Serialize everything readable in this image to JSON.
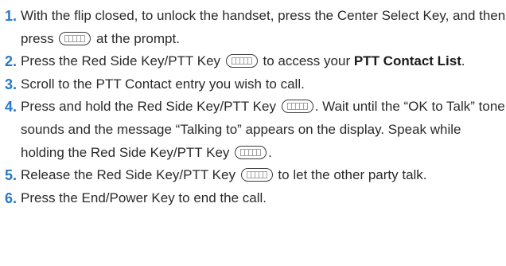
{
  "steps": [
    {
      "num": "1.",
      "text_a": "With the flip closed, to unlock the handset, press the Center Select Key, and then press",
      "text_b": "at the prompt."
    },
    {
      "num": "2.",
      "text_a": "Press the Red Side Key/PTT Key",
      "text_b": "to access your",
      "bold": "PTT Contact List",
      "text_c": "."
    },
    {
      "num": "3.",
      "text_a": "Scroll to the PTT Contact entry you wish to call."
    },
    {
      "num": "4.",
      "text_a": "Press and hold the Red Side Key/PTT Key",
      "text_b": ". Wait until the “OK to Talk” tone sounds and the message “Talking to” appears on the display. Speak while holding the Red Side Key/PTT Key",
      "text_c": "."
    },
    {
      "num": "5.",
      "text_a": "Release the Red Side Key/PTT Key",
      "text_b": "to let the other party talk."
    },
    {
      "num": "6.",
      "text_a": "Press the End/Power Key to end the call."
    }
  ]
}
